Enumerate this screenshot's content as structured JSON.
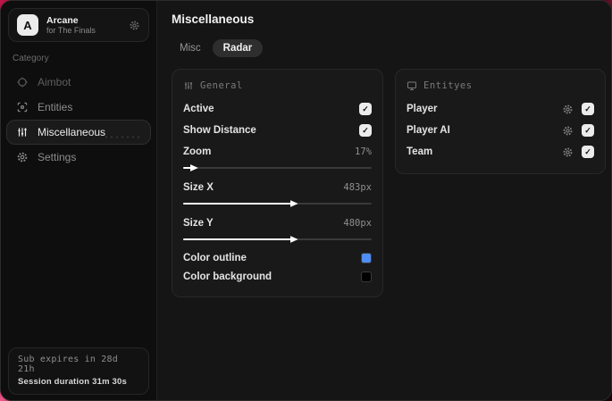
{
  "sidebar": {
    "profile": {
      "avatar_letter": "A",
      "name": "Arcane",
      "subtitle": "for The Finals"
    },
    "category_label": "Category",
    "items": [
      {
        "label": "Aimbot"
      },
      {
        "label": "Entities"
      },
      {
        "label": "Miscellaneous"
      },
      {
        "label": "Settings"
      }
    ],
    "footer": {
      "expiry": "Sub expires in 28d 21h",
      "session": "Session duration 31m 30s"
    }
  },
  "main": {
    "title": "Miscellaneous",
    "tabs": [
      {
        "label": "Misc"
      },
      {
        "label": "Radar"
      }
    ],
    "active_tab": "Radar",
    "general": {
      "title": "General",
      "toggles": [
        {
          "label": "Active",
          "checked": true
        },
        {
          "label": "Show Distance",
          "checked": true
        }
      ],
      "sliders": [
        {
          "label": "Zoom",
          "value": "17%",
          "fill": "7%"
        },
        {
          "label": "Size X",
          "value": "483px",
          "fill": "60%"
        },
        {
          "label": "Size Y",
          "value": "480px",
          "fill": "60%"
        }
      ],
      "colors": [
        {
          "label": "Color outline",
          "hex": "#4f8ef7"
        },
        {
          "label": "Color background",
          "hex": "#000000"
        }
      ]
    },
    "entities": {
      "title": "Entityes",
      "rows": [
        {
          "label": "Player",
          "checked": true
        },
        {
          "label": "Player AI",
          "checked": true
        },
        {
          "label": "Team",
          "checked": true
        }
      ]
    }
  },
  "icons": {
    "check": "✓"
  }
}
